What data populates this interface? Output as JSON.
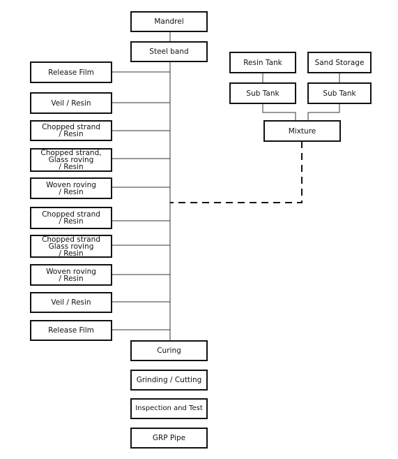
{
  "main_flow": {
    "mandrel": "Mandrel",
    "steel_band": "Steel band",
    "curing": "Curing",
    "grinding": "Grinding / Cutting",
    "inspection": "Inspection and Test",
    "grp_pipe": "GRP Pipe"
  },
  "layers": [
    "Release Film",
    "Veil / Resin",
    "Chopped strand\n / Resin",
    "Chopped strand,\nGlass roving\n / Resin",
    "Woven roving\n / Resin",
    "Chopped strand\n / Resin",
    "Chopped strand\nGlass roving\n / Resin",
    "Woven roving\n / Resin",
    "Veil / Resin",
    "Release Film"
  ],
  "supply": {
    "resin_tank": "Resin Tank",
    "sand_storage": "Sand Storage",
    "resin_sub_tank": "Sub Tank",
    "sand_sub_tank": "Sub Tank",
    "mixture": "Mixture"
  }
}
